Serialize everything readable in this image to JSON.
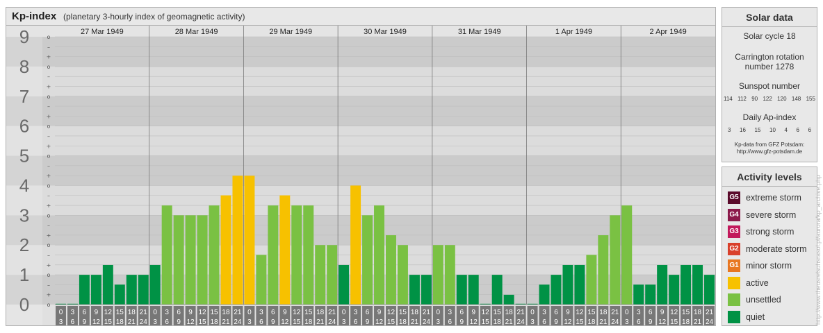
{
  "header": {
    "title": "Kp-index",
    "subtitle": "(planetary 3-hourly index of geomagnetic activity)"
  },
  "chart_data": {
    "type": "bar",
    "ylim": [
      0,
      9
    ],
    "y_ticks": [
      "0",
      "1",
      "2",
      "3",
      "4",
      "5",
      "6",
      "7",
      "8",
      "9"
    ],
    "minor_tick_labels": [
      "o",
      "+",
      "–"
    ],
    "days": [
      {
        "date": "27 Mar 1949",
        "values": [
          0,
          0,
          1,
          1,
          1.33,
          0.67,
          1,
          1
        ]
      },
      {
        "date": "28 Mar 1949",
        "values": [
          1.33,
          3.33,
          3,
          3,
          3,
          3.33,
          3.67,
          4.33
        ]
      },
      {
        "date": "29 Mar 1949",
        "values": [
          4.33,
          1.67,
          3.33,
          3.67,
          3.33,
          3.33,
          2,
          2
        ]
      },
      {
        "date": "30 Mar 1949",
        "values": [
          1.33,
          4,
          3,
          3.33,
          2.33,
          2,
          1,
          1
        ]
      },
      {
        "date": "31 Mar 1949",
        "values": [
          2,
          2,
          1,
          1,
          0,
          1,
          0.33,
          0
        ]
      },
      {
        "date": "1 Apr 1949",
        "values": [
          0,
          0.67,
          1,
          1.33,
          1.33,
          1.67,
          2.33,
          3
        ]
      },
      {
        "date": "2 Apr 1949",
        "values": [
          3.33,
          0.67,
          0.67,
          1.33,
          1,
          1.33,
          1.33,
          1
        ]
      }
    ],
    "hour_start": [
      "0",
      "3",
      "6",
      "9",
      "12",
      "15",
      "18",
      "21"
    ],
    "hour_end": [
      "3",
      "6",
      "9",
      "12",
      "15",
      "18",
      "21",
      "24"
    ],
    "colors": {
      "quiet": "#009245",
      "unsettled": "#7ac143",
      "active": "#f7c100",
      "g1": "#e87722",
      "g2": "#d9402b",
      "g3": "#c2185b",
      "g4": "#8b1a4a",
      "g5": "#5a0a2a",
      "band_dark": "#cbcbcb",
      "band_light": "#dcdcdc",
      "hour_box": "#777777"
    }
  },
  "solar": {
    "title": "Solar data",
    "cycle": "Solar cycle 18",
    "carrington": "Carrington rotation number 1278",
    "sunspot_label": "Sunspot number",
    "sunspots": [
      "114",
      "112",
      "90",
      "122",
      "120",
      "148",
      "155"
    ],
    "ap_label": "Daily Ap-index",
    "ap": [
      "3",
      "16",
      "15",
      "10",
      "4",
      "6",
      "6"
    ],
    "source_line1": "Kp-data from GFZ Potsdam:",
    "source_line2": "http://www.gfz-potsdam.de"
  },
  "activity": {
    "title": "Activity levels",
    "levels": [
      {
        "code": "G5",
        "label": "extreme storm",
        "color": "#5a0a2a"
      },
      {
        "code": "G4",
        "label": "severe storm",
        "color": "#8b1a4a"
      },
      {
        "code": "G3",
        "label": "strong storm",
        "color": "#c2185b"
      },
      {
        "code": "G2",
        "label": "moderate storm",
        "color": "#d9402b"
      },
      {
        "code": "G1",
        "label": "minor storm",
        "color": "#e87722"
      },
      {
        "code": "",
        "label": "active",
        "color": "#f7c100"
      },
      {
        "code": "",
        "label": "unsettled",
        "color": "#7ac143"
      },
      {
        "code": "",
        "label": "quiet",
        "color": "#009245"
      }
    ]
  },
  "watermark": "http://www.theusrelsuhsrasol.pl/aurora/kp_archive.php"
}
